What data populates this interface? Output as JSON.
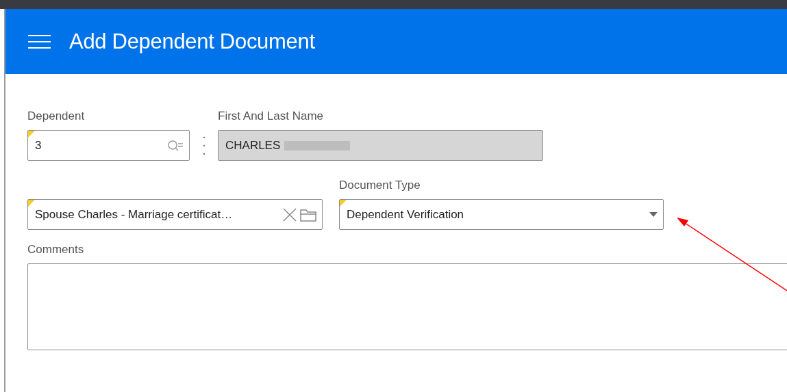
{
  "header": {
    "title": "Add Dependent Document"
  },
  "fields": [
    {
      "kind": "lookup",
      "label": "Dependent",
      "value": "3",
      "required": true,
      "disabled": false
    },
    {
      "kind": "text",
      "label": "First And Last Name",
      "value": "CHARLES",
      "required": false,
      "disabled": true,
      "redacted": true
    }
  ],
  "row2": [
    {
      "kind": "file",
      "value": "Spouse Charles - Marriage certificat…",
      "required": true,
      "disabled": false
    },
    {
      "kind": "select",
      "label": "Document Type",
      "value": "Dependent Verification",
      "required": true,
      "disabled": false
    }
  ],
  "comments": {
    "label": "Comments"
  },
  "annotation": {
    "kind": "arrow",
    "color": "#ff0000"
  }
}
